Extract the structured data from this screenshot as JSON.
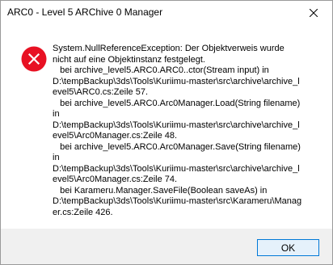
{
  "window": {
    "title": "ARC0 - Level 5 ARChive 0 Manager"
  },
  "dialog": {
    "icon": "error-icon",
    "icon_color": "#e81123",
    "message_lines": [
      "System.NullReferenceException: Der Objektverweis wurde",
      "nicht auf eine Objektinstanz festgelegt.",
      "   bei archive_level5.ARC0.ARC0..ctor(Stream input) in",
      "D:\\tempBackup\\3ds\\Tools\\Kuriimu-master\\src\\archive\\archive_l",
      "evel5\\ARC0.cs:Zeile 57.",
      "   bei archive_level5.ARC0.Arc0Manager.Load(String filename)",
      "in",
      "D:\\tempBackup\\3ds\\Tools\\Kuriimu-master\\src\\archive\\archive_l",
      "evel5\\Arc0Manager.cs:Zeile 48.",
      "   bei archive_level5.ARC0.Arc0Manager.Save(String filename)",
      "in",
      "D:\\tempBackup\\3ds\\Tools\\Kuriimu-master\\src\\archive\\archive_l",
      "evel5\\Arc0Manager.cs:Zeile 74.",
      "   bei Karameru.Manager.SaveFile(Boolean saveAs) in",
      "D:\\tempBackup\\3ds\\Tools\\Kuriimu-master\\src\\Karameru\\Manag",
      "er.cs:Zeile 426."
    ],
    "ok_label": "OK"
  }
}
